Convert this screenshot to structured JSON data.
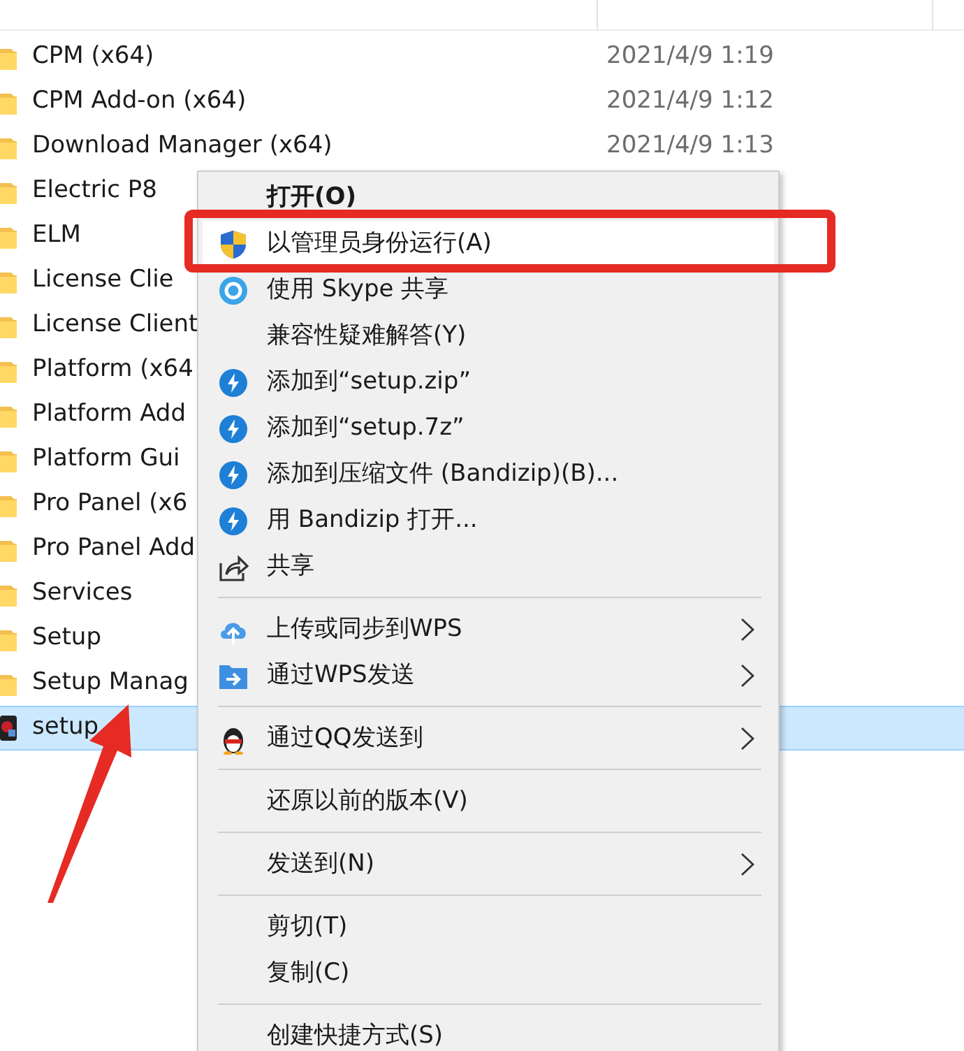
{
  "files": [
    {
      "name": "CPM (x64)",
      "modified": "2021/4/9 1:19",
      "kind": "folder",
      "selected": false
    },
    {
      "name": "CPM Add-on (x64)",
      "modified": "2021/4/9 1:12",
      "kind": "folder",
      "selected": false
    },
    {
      "name": "Download Manager (x64)",
      "modified": "2021/4/9 1:13",
      "kind": "folder",
      "selected": false
    },
    {
      "name": "Electric P8",
      "kind": "folder",
      "selected": false
    },
    {
      "name": "ELM",
      "kind": "folder",
      "selected": false
    },
    {
      "name": "License Clie",
      "kind": "folder",
      "selected": false
    },
    {
      "name": "License Client",
      "kind": "folder",
      "selected": false
    },
    {
      "name": "Platform (x64",
      "kind": "folder",
      "selected": false
    },
    {
      "name": "Platform Add",
      "kind": "folder",
      "selected": false
    },
    {
      "name": "Platform Gui",
      "kind": "folder",
      "selected": false
    },
    {
      "name": "Pro Panel (x6",
      "kind": "folder",
      "selected": false
    },
    {
      "name": "Pro Panel Add",
      "kind": "folder",
      "selected": false
    },
    {
      "name": "Services",
      "kind": "folder",
      "selected": false
    },
    {
      "name": "Setup",
      "kind": "folder",
      "selected": false
    },
    {
      "name": "Setup Manag",
      "kind": "folder",
      "selected": false
    },
    {
      "name": "setup",
      "kind": "app",
      "selected": true
    }
  ],
  "context_menu": [
    {
      "kind": "item",
      "label": "打开(O)",
      "default": true,
      "selected": false,
      "submenu": false
    },
    {
      "kind": "item",
      "label": "以管理员身份运行(A)",
      "default": false,
      "selected": true,
      "submenu": false
    },
    {
      "kind": "item",
      "label": "使用 Skype 共享",
      "default": false,
      "selected": false,
      "submenu": false
    },
    {
      "kind": "item",
      "label": "兼容性疑难解答(Y)",
      "default": false,
      "selected": false,
      "submenu": false
    },
    {
      "kind": "item",
      "label": "添加到“setup.zip”",
      "default": false,
      "selected": false,
      "submenu": false
    },
    {
      "kind": "item",
      "label": "添加到“setup.7z”",
      "default": false,
      "selected": false,
      "submenu": false
    },
    {
      "kind": "item",
      "label": "添加到压缩文件 (Bandizip)(B)...",
      "default": false,
      "selected": false,
      "submenu": false
    },
    {
      "kind": "item",
      "label": "用 Bandizip 打开...",
      "default": false,
      "selected": false,
      "submenu": false
    },
    {
      "kind": "item",
      "label": "共享",
      "default": false,
      "selected": false,
      "submenu": false
    },
    {
      "kind": "separator"
    },
    {
      "kind": "item",
      "label": "上传或同步到WPS",
      "default": false,
      "selected": false,
      "submenu": true
    },
    {
      "kind": "item",
      "label": "通过WPS发送",
      "default": false,
      "selected": false,
      "submenu": true
    },
    {
      "kind": "separator"
    },
    {
      "kind": "item",
      "label": "通过QQ发送到",
      "default": false,
      "selected": false,
      "submenu": true
    },
    {
      "kind": "separator"
    },
    {
      "kind": "item",
      "label": "还原以前的版本(V)",
      "default": false,
      "selected": false,
      "submenu": false
    },
    {
      "kind": "separator"
    },
    {
      "kind": "item",
      "label": "发送到(N)",
      "default": false,
      "selected": false,
      "submenu": true
    },
    {
      "kind": "separator"
    },
    {
      "kind": "item",
      "label": "剪切(T)",
      "default": false,
      "selected": false,
      "submenu": false
    },
    {
      "kind": "item",
      "label": "复制(C)",
      "default": false,
      "selected": false,
      "submenu": false
    },
    {
      "kind": "separator"
    },
    {
      "kind": "item",
      "label": "创建快捷方式(S)",
      "default": false,
      "selected": false,
      "submenu": false
    }
  ]
}
